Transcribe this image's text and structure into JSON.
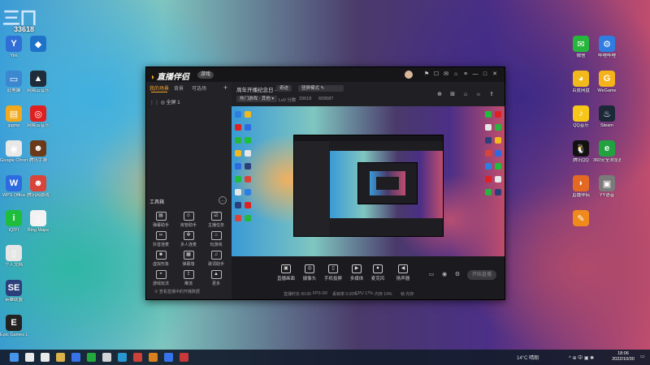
{
  "desktop": {
    "corner_id": "33618",
    "left_icons": [
      {
        "label": "Yim",
        "color": "#2f6fd6",
        "glyph": "Y"
      },
      {
        "label": "此电脑",
        "color": "#3b87d0",
        "glyph": "▭"
      },
      {
        "label": "jpgmp",
        "color": "#f0a81c",
        "glyph": "▤"
      },
      {
        "label": "Google Chrome",
        "color": "#e8e8e8",
        "glyph": "◉"
      },
      {
        "label": "WPS Office",
        "color": "#2d6be0",
        "glyph": "W"
      },
      {
        "label": "iQIYI",
        "color": "#1ebd3c",
        "glyph": "i"
      },
      {
        "label": "个人文档",
        "color": "#e6e6e6",
        "glyph": "▯"
      },
      {
        "label": "英雄联盟",
        "color": "#2b3f7a",
        "glyph": "SE"
      },
      {
        "label": "Epic Games Launcher",
        "color": "#222222",
        "glyph": "E"
      }
    ],
    "second_col_icons": [
      {
        "label": "",
        "color": "#1e73c8",
        "glyph": "◆"
      },
      {
        "label": "网易云音乐",
        "color": "#1f2c3a",
        "glyph": "▲"
      },
      {
        "label": "网易云音乐",
        "color": "#e02020",
        "glyph": "◎"
      },
      {
        "label": "腾讯手游",
        "color": "#6a3a1a",
        "glyph": "☻"
      },
      {
        "label": "腾讯网游戏",
        "color": "#d9443a",
        "glyph": "☻"
      },
      {
        "label": "Bing Maps",
        "color": "#f2f2f2",
        "glyph": "▯"
      }
    ],
    "right_icons": [
      {
        "label": "微信",
        "color": "#27b63c",
        "glyph": "✉"
      },
      {
        "label": "哔哩哔哩",
        "color": "#2f7de0",
        "glyph": "⚙"
      },
      {
        "label": "百度网盘",
        "color": "#f2b91d",
        "glyph": "◕"
      },
      {
        "label": "WeGame",
        "color": "#f5b21b",
        "glyph": "G"
      },
      {
        "label": "QQ音乐",
        "color": "#f6c719",
        "glyph": "♪"
      },
      {
        "label": "Steam",
        "color": "#1b2838",
        "glyph": "♨"
      },
      {
        "label": "腾讯QQ",
        "color": "#111111",
        "glyph": "🐧"
      },
      {
        "label": "360安全浏览器",
        "color": "#22a140",
        "glyph": "e"
      },
      {
        "label": "直播伴侣",
        "color": "#e46a22",
        "glyph": "◗"
      },
      {
        "label": "YY语音",
        "color": "#7a7a7a",
        "glyph": "▣"
      },
      {
        "label": "",
        "color": "#f08a1c",
        "glyph": "✎"
      }
    ]
  },
  "app": {
    "brand": "直播伴侣",
    "badge": "游戏",
    "window_buttons": [
      "⚑",
      "☐",
      "✉",
      "⌂",
      "≡",
      "—",
      "□",
      "✕"
    ],
    "left_tabs": [
      {
        "label": "我的场景",
        "active": true
      },
      {
        "label": "背景",
        "active": false
      },
      {
        "label": "可选场",
        "active": false
      }
    ],
    "scene_item": "⋮⋮  ◎  全屏 1",
    "tools_header": "工具箱",
    "tools": [
      {
        "label": "弹幕助手",
        "glyph": "▤"
      },
      {
        "label": "房管助手",
        "glyph": "☺"
      },
      {
        "label": "主播任务",
        "glyph": "☑"
      },
      {
        "label": "抖音连麦",
        "glyph": "∞"
      },
      {
        "label": "多人连麦",
        "glyph": "✜"
      },
      {
        "label": "玩游戏",
        "glyph": "⌂"
      },
      {
        "label": "虚拟形象",
        "glyph": "☻"
      },
      {
        "label": "弹幕墙",
        "glyph": "▦"
      },
      {
        "label": "歌词助手",
        "glyph": "♫"
      },
      {
        "label": "游戏玩法",
        "glyph": "◓"
      },
      {
        "label": "推流",
        "glyph": "⇪"
      },
      {
        "label": "更多",
        "glyph": "▲"
      }
    ],
    "hint": "① 查看直播中的开播数据",
    "room_title": "周年开播纪念日 -",
    "room_tag": "奇迹",
    "mode": "竖屏模式",
    "category": "热门游戏 · 其他 ▾",
    "meta": [
      "Lv0 分数",
      "33618",
      "609587"
    ],
    "right_icons": [
      "⊕",
      "⊞",
      "⌂",
      "☼",
      "⇪"
    ],
    "controls": [
      {
        "label": "直播画面",
        "glyph": "▣"
      },
      {
        "label": "摄像头",
        "glyph": "◎"
      },
      {
        "label": "手机投屏",
        "glyph": "▯"
      },
      {
        "label": "多媒体",
        "glyph": "▶"
      },
      {
        "label": "麦克风",
        "glyph": "⏺"
      },
      {
        "label": "扬声器",
        "glyph": "◀"
      }
    ],
    "aux_controls": [
      "▭",
      "◉",
      "⚙"
    ],
    "go_live": "开始直播",
    "status": [
      "直播时长 00:00",
      "FPS 0/0",
      "丢帧率 0.00%",
      "CPU 17%",
      "内存 14%",
      "帧 内存"
    ]
  },
  "taskbar": {
    "apps": [
      {
        "name": "windows",
        "color": "#4aa3ff"
      },
      {
        "name": "search",
        "color": "#ffffff"
      },
      {
        "name": "task-view",
        "color": "#ffffff"
      },
      {
        "name": "explorer",
        "color": "#f2c14e"
      },
      {
        "name": "feishu",
        "color": "#3a7bff"
      },
      {
        "name": "wechat",
        "color": "#27b63c"
      },
      {
        "name": "qq",
        "color": "#e6e6e6"
      },
      {
        "name": "edge",
        "color": "#2ba3e0"
      },
      {
        "name": "chrome",
        "color": "#e0443a"
      },
      {
        "name": "douyin-live",
        "color": "#f08a1c"
      },
      {
        "name": "store",
        "color": "#3a7bff"
      },
      {
        "name": "app-red",
        "color": "#d93a3a"
      }
    ],
    "weather": "14°C 晴朗",
    "tray": "^ ⊕ 中 ▣ ✱",
    "time": "18:06",
    "date": "2022/10/30"
  }
}
